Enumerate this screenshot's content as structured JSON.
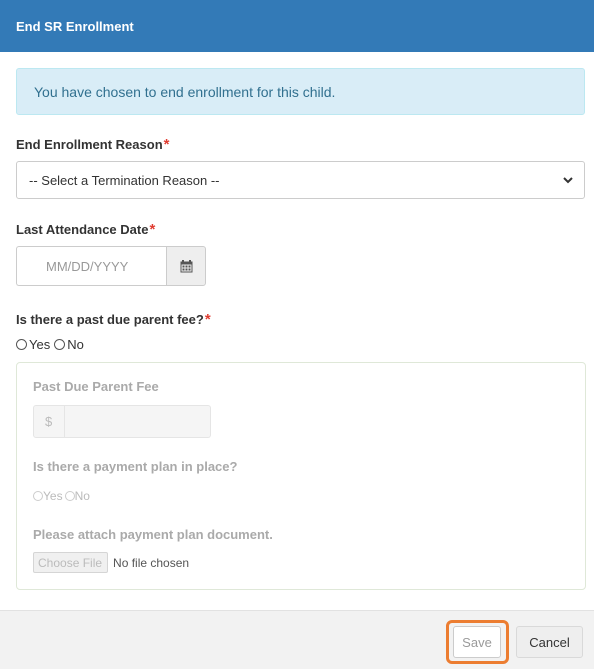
{
  "dialog": {
    "title": "End SR Enrollment"
  },
  "alert": {
    "message": "You have chosen to end enrollment for this child."
  },
  "end_reason": {
    "label": "End Enrollment Reason",
    "required_mark": "*",
    "selected": "-- Select a Termination Reason --"
  },
  "last_attendance": {
    "label": "Last Attendance Date",
    "required_mark": "*",
    "placeholder": "MM/DD/YYYY",
    "icon": "calendar-icon"
  },
  "past_due": {
    "label": "Is there a past due parent fee?",
    "required_mark": "*",
    "yes_label": "Yes",
    "no_label": "No",
    "selected": null
  },
  "past_due_details": {
    "fee_label": "Past Due Parent Fee",
    "currency_symbol": "$",
    "fee_value": "",
    "payment_plan_label": "Is there a payment plan in place?",
    "plan_yes_label": "Yes",
    "plan_no_label": "No",
    "attach_label": "Please attach payment plan document.",
    "choose_file_label": "Choose File",
    "file_status": "No file chosen",
    "disabled": true
  },
  "footer": {
    "save_label": "Save",
    "cancel_label": "Cancel"
  },
  "colors": {
    "header_bg": "#337ab7",
    "alert_bg": "#d9edf7",
    "alert_text": "#31708f",
    "required": "#e03c31",
    "save_highlight": "#ec7d31"
  }
}
